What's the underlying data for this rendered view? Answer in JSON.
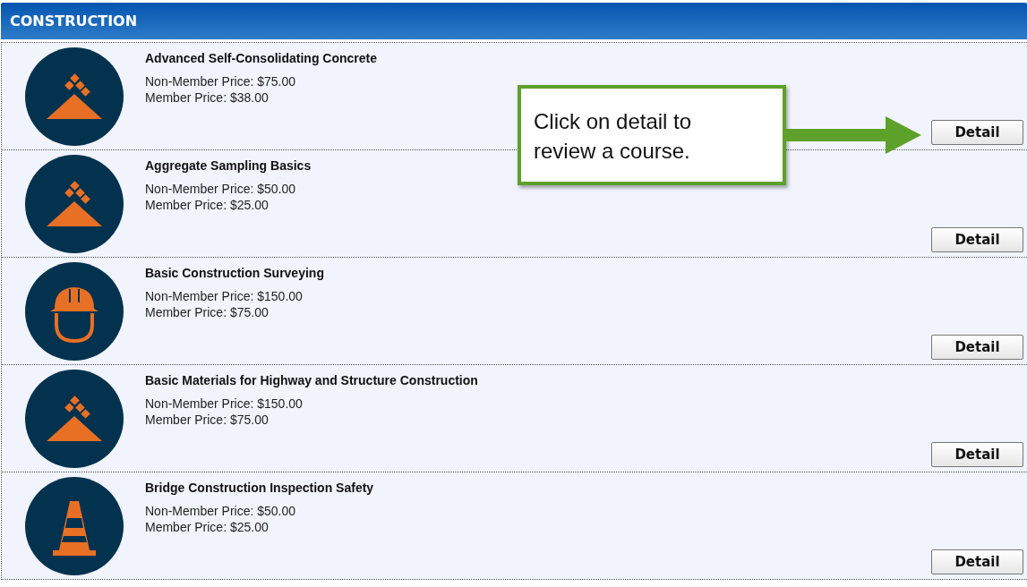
{
  "section": {
    "title": "CONSTRUCTION"
  },
  "courses": [
    {
      "title": "Advanced Self-Consolidating Concrete",
      "kind": "aggregate",
      "non_member_price": "Non-Member Price: $75.00",
      "member_price": "Member Price: $38.00",
      "button": "Detail"
    },
    {
      "title": "Aggregate Sampling Basics",
      "kind": "aggregate",
      "non_member_price": "Non-Member Price: $50.00",
      "member_price": "Member Price: $25.00",
      "button": "Detail"
    },
    {
      "title": "Basic Construction Surveying",
      "kind": "hardhat",
      "non_member_price": "Non-Member Price: $150.00",
      "member_price": "Member Price: $75.00",
      "button": "Detail"
    },
    {
      "title": "Basic Materials for Highway and Structure Construction",
      "kind": "aggregate",
      "non_member_price": "Non-Member Price: $150.00",
      "member_price": "Member Price: $75.00",
      "button": "Detail"
    },
    {
      "title": "Bridge Construction Inspection Safety",
      "kind": "cone",
      "non_member_price": "Non-Member Price: $50.00",
      "member_price": "Member Price: $25.00",
      "button": "Detail"
    }
  ],
  "callout": {
    "text": "Click on detail to review a course."
  }
}
